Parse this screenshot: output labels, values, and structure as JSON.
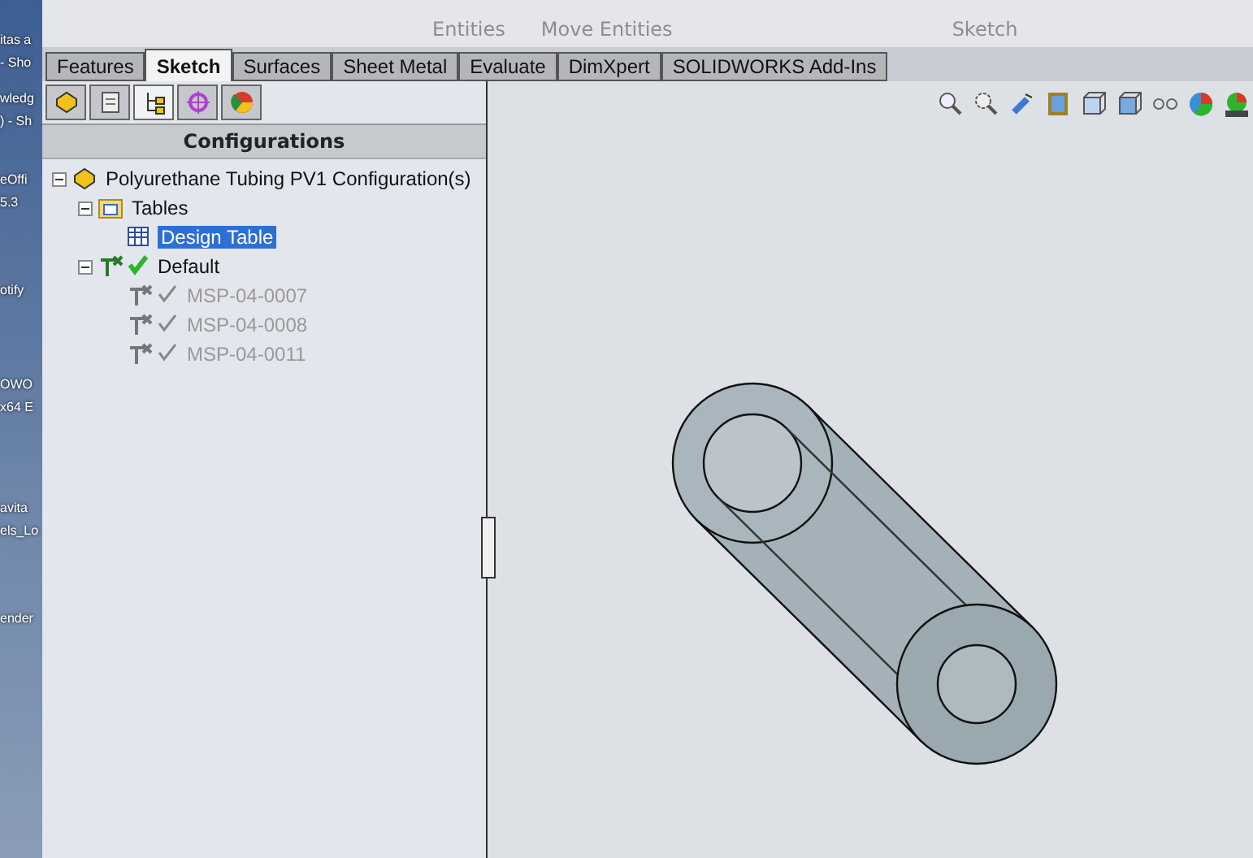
{
  "desktop": {
    "labels": [
      {
        "text": "itas a"
      },
      {
        "text": "- Sho"
      },
      {
        "text": "wledg"
      },
      {
        "text": ") - Sh"
      },
      {
        "text": "eOffi"
      },
      {
        "text": "5.3"
      },
      {
        "text": "otify"
      },
      {
        "text": "OWO"
      },
      {
        "text": "x64 E"
      },
      {
        "text": "avita"
      },
      {
        "text": "els_Lo"
      },
      {
        "text": "ender"
      }
    ]
  },
  "toolbar": {
    "labels": [
      "Entities",
      "Move Entities",
      "Sketch"
    ]
  },
  "tabs": [
    {
      "label": "Features",
      "selected": false
    },
    {
      "label": "Sketch",
      "selected": true
    },
    {
      "label": "Surfaces",
      "selected": false
    },
    {
      "label": "Sheet Metal",
      "selected": false
    },
    {
      "label": "Evaluate",
      "selected": false
    },
    {
      "label": "DimXpert",
      "selected": false
    },
    {
      "label": "SOLIDWORKS Add-Ins",
      "selected": false
    }
  ],
  "manager_tabs": [
    {
      "kind": "feature",
      "selected": false
    },
    {
      "kind": "property",
      "selected": false
    },
    {
      "kind": "configuration",
      "selected": true
    },
    {
      "kind": "dimxpert",
      "selected": false
    },
    {
      "kind": "display",
      "selected": false
    }
  ],
  "panel": {
    "title": "Configurations"
  },
  "tree": [
    {
      "label": "Polyurethane Tubing PV1 Configuration(s)",
      "kind": "part",
      "children": [
        {
          "label": "Tables",
          "kind": "folder",
          "children": [
            {
              "label": "Design Table",
              "kind": "table",
              "selected": true
            }
          ]
        },
        {
          "label": "Default",
          "kind": "config",
          "active": true,
          "children": [
            {
              "label": "MSP-04-0007",
              "kind": "config",
              "active": false
            },
            {
              "label": "MSP-04-0008",
              "kind": "config",
              "active": false
            },
            {
              "label": "MSP-04-0011",
              "kind": "config",
              "active": false
            }
          ]
        }
      ]
    }
  ]
}
